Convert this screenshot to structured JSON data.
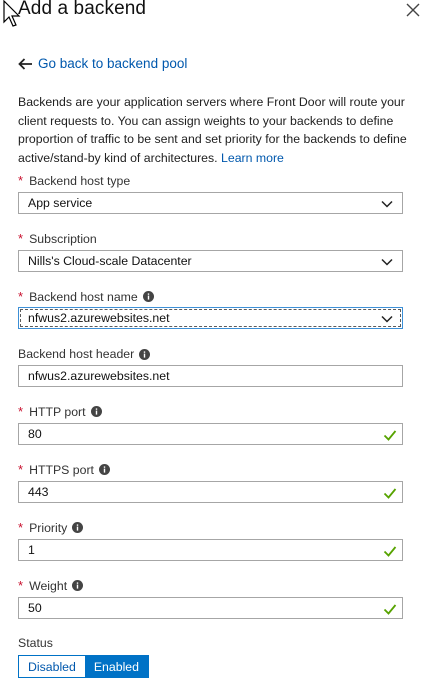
{
  "header": {
    "title": "Add a backend"
  },
  "back_link": {
    "label": "Go back to backend pool"
  },
  "description": {
    "text": "Backends are your application servers where Front Door will route your client requests to. You can assign weights to your backends to define proportion of traffic to be sent and set priority for the backends to define active/stand-by kind of architectures.",
    "learn_more": "Learn more"
  },
  "fields": {
    "host_type": {
      "label": "Backend host type",
      "value": "App service"
    },
    "subscription": {
      "label": "Subscription",
      "value": "Nills's Cloud-scale Datacenter"
    },
    "host_name": {
      "label": "Backend host name",
      "value": "nfwus2.azurewebsites.net"
    },
    "host_header": {
      "label": "Backend host header",
      "value": "nfwus2.azurewebsites.net"
    },
    "http_port": {
      "label": "HTTP port",
      "value": "80"
    },
    "https_port": {
      "label": "HTTPS port",
      "value": "443"
    },
    "priority": {
      "label": "Priority",
      "value": "1"
    },
    "weight": {
      "label": "Weight",
      "value": "50"
    }
  },
  "status": {
    "label": "Status",
    "options": [
      "Disabled",
      "Enabled"
    ],
    "selected": "Enabled"
  },
  "colors": {
    "link": "#0058ad",
    "accent": "#0072c6",
    "required": "#c8102e",
    "valid": "#57a300"
  },
  "icons": {
    "close": "close-icon",
    "back": "arrow-left-icon",
    "info": "info-icon",
    "chevron": "chevron-down-icon",
    "check": "checkmark-icon"
  }
}
